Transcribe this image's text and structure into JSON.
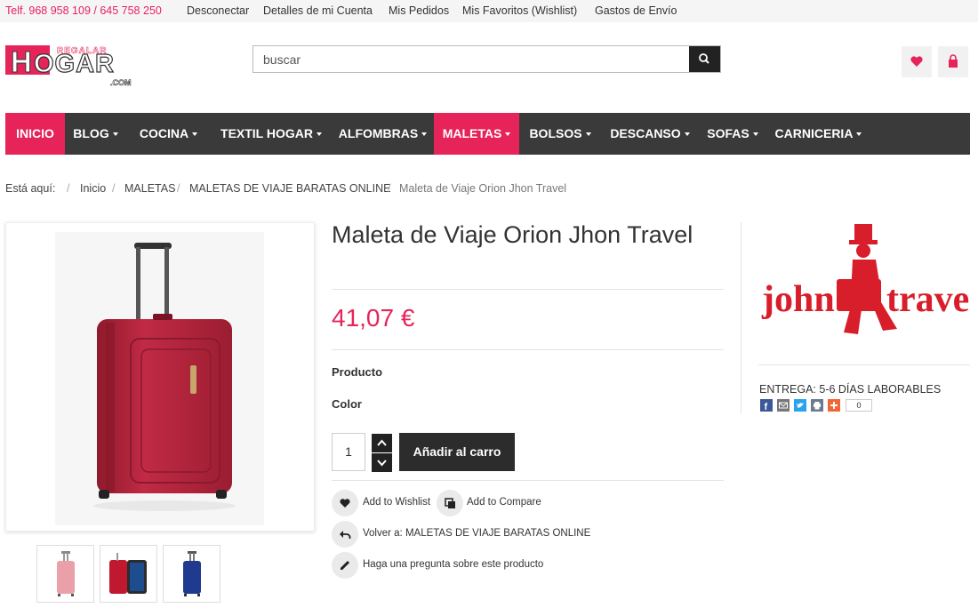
{
  "topbar": {
    "phone": "Telf. 968 958 109 / 645 758 250",
    "links": [
      "Desconectar",
      "Detalles de mi Cuenta",
      "Mis Pedidos",
      "Mis Favoritos (Wishlist)",
      "Gastos de Envío"
    ]
  },
  "logo": {
    "line1": "REGALAR",
    "line2": "HOGAR",
    "line3": ".COM"
  },
  "search": {
    "value": "buscar",
    "icon": "search-icon"
  },
  "header_icons": [
    "heart-icon",
    "bag-icon"
  ],
  "nav": [
    {
      "label": "INICIO",
      "dropdown": false,
      "active": true
    },
    {
      "label": "BLOG",
      "dropdown": true,
      "active": false
    },
    {
      "label": "COCINA",
      "dropdown": true,
      "active": false
    },
    {
      "label": "TEXTIL HOGAR",
      "dropdown": true,
      "active": false
    },
    {
      "label": "ALFOMBRAS",
      "dropdown": true,
      "active": false
    },
    {
      "label": "MALETAS",
      "dropdown": true,
      "active": true
    },
    {
      "label": "BOLSOS",
      "dropdown": true,
      "active": false
    },
    {
      "label": "DESCANSO",
      "dropdown": true,
      "active": false
    },
    {
      "label": "SOFAS",
      "dropdown": true,
      "active": false
    },
    {
      "label": "CARNICERIA",
      "dropdown": true,
      "active": false
    }
  ],
  "breadcrumb": {
    "prefix": "Está aquí:",
    "items": [
      "Inicio",
      "MALETAS",
      "MALETAS DE VIAJE BARATAS ONLINE"
    ],
    "current": "Maleta de Viaje Orion Jhon Travel"
  },
  "product": {
    "title": "Maleta de Viaje Orion Jhon Travel",
    "price": "41,07 €",
    "label_producto": "Producto",
    "label_color": "Color",
    "quantity": "1",
    "add_to_cart": "Añadir al carro",
    "actions": {
      "wishlist": "Add to Wishlist",
      "compare": "Add to Compare",
      "back": "Volver a: MALETAS DE VIAJE BARATAS ONLINE",
      "question": "Haga una pregunta sobre este producto"
    }
  },
  "sidebar": {
    "brand": {
      "left": "john",
      "right": "travel"
    },
    "delivery": "ENTREGA: 5-6 DÍAS LABORABLES",
    "share_count": "0",
    "share_icons": [
      "facebook-icon",
      "email-icon",
      "twitter-icon",
      "print-icon",
      "plus-icon"
    ]
  },
  "colors": {
    "accent": "#e6245a",
    "nav_bg": "#3a3a3a",
    "button_bg": "#2c2c2c",
    "suitcase_red": "#b0213a",
    "thumb_colors": [
      "#e9a0a8",
      "#c0182e",
      "#1f3a8f"
    ]
  }
}
